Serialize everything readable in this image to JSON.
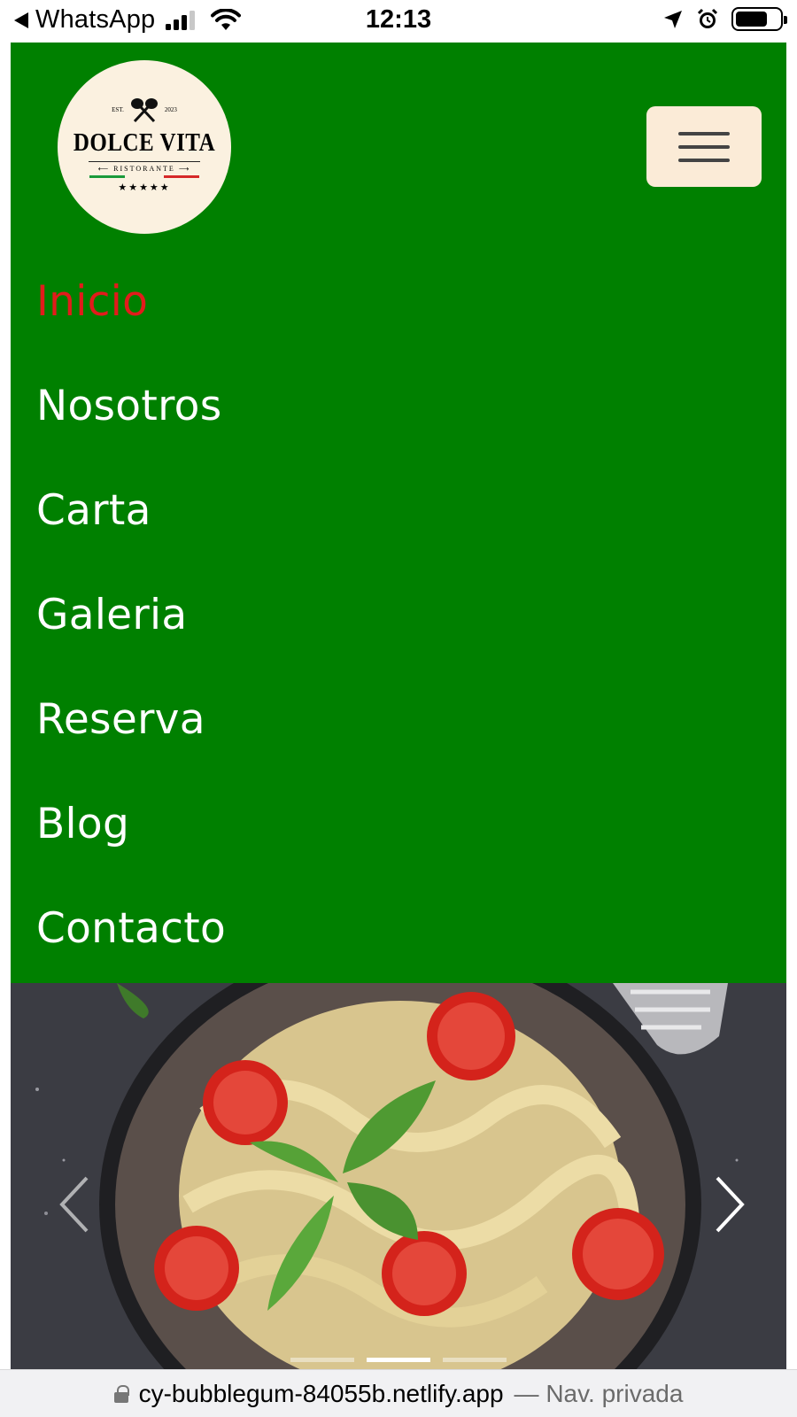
{
  "status_bar": {
    "back_app": "WhatsApp",
    "time": "12:13"
  },
  "header": {
    "logo": {
      "est": "EST.",
      "year": "2023",
      "name": "DOLCE VITA",
      "sub": "RISTORANTE",
      "stars": "★★★★★"
    },
    "menu_button_icon": "hamburger-icon"
  },
  "nav": {
    "items": [
      {
        "label": "Inicio",
        "active": true
      },
      {
        "label": "Nosotros"
      },
      {
        "label": "Carta"
      },
      {
        "label": "Galeria"
      },
      {
        "label": "Reserva"
      },
      {
        "label": "Blog"
      },
      {
        "label": "Contacto"
      }
    ]
  },
  "carousel": {
    "prev_icon": "chevron-left-icon",
    "next_icon": "chevron-right-icon",
    "indicator_count": 3,
    "active_index": 1
  },
  "address_bar": {
    "url": "cy-bubblegum-84055b.netlify.app",
    "mode": "— Nav. privada"
  },
  "colors": {
    "header_bg": "#008000",
    "nav_text": "#ffffff",
    "nav_active": "#e21b1b",
    "logo_bg": "#fbf1e0",
    "menu_button_bg": "#fbebd7"
  }
}
